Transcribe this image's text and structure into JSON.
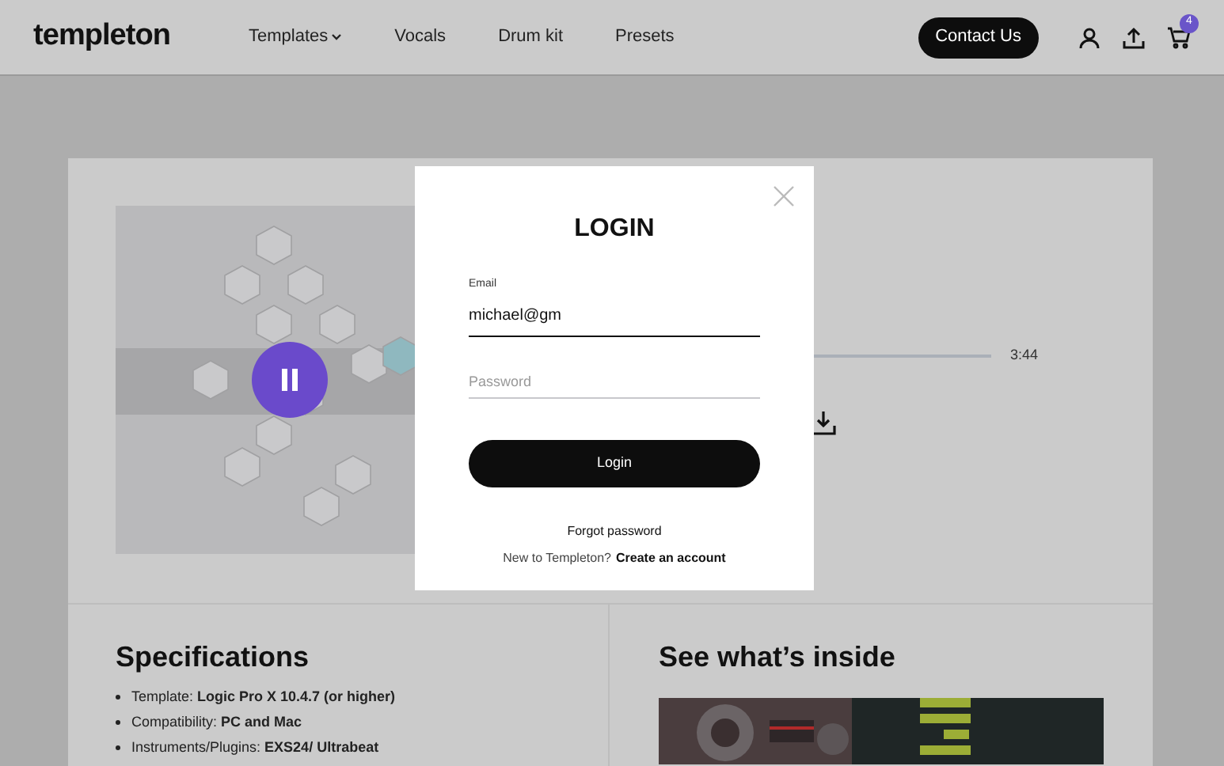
{
  "header": {
    "logo": "templeton",
    "nav": [
      {
        "label": "Templates",
        "dropdown": true
      },
      {
        "label": "Vocals",
        "dropdown": false
      },
      {
        "label": "Drum kit",
        "dropdown": false
      },
      {
        "label": "Presets",
        "dropdown": false
      }
    ],
    "contact_button": "Contact Us",
    "cart_count": "4"
  },
  "player": {
    "playing": true,
    "duration": "3:44"
  },
  "specifications": {
    "title": "Specifications",
    "items": [
      "Template: **Logic Pro X 10.4.7 (or higher)**",
      "Compatibility: **PC and Mac**",
      "Instruments/Plugins: **EXS24/ Ultrabeat**"
    ]
  },
  "inside": {
    "title": "See what’s inside"
  },
  "login_modal": {
    "title": "LOGIN",
    "email_label": "Email",
    "email_value": "michael@gm",
    "password_placeholder": "Password",
    "login_button": "Login",
    "forgot_link": "Forgot password",
    "signup_prompt": "New to Templeton?",
    "signup_link": "Create an account"
  }
}
